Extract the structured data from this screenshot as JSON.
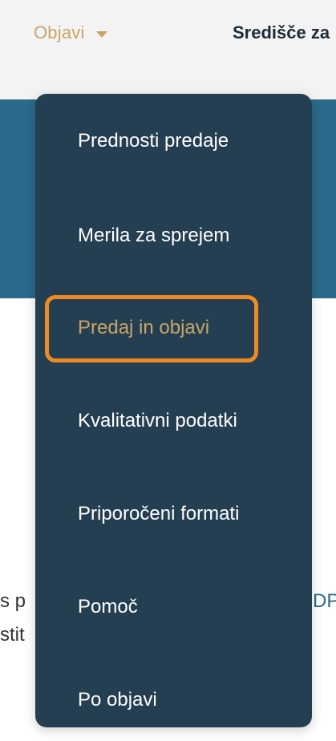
{
  "nav": {
    "objavi_label": "Objavi",
    "sredisce_label": "Središče za"
  },
  "background": {
    "text_line_1": "s p",
    "text_line_2": "stit",
    "text_right_fragment": "DP"
  },
  "dropdown": {
    "items": [
      {
        "label": "Prednosti predaje"
      },
      {
        "label": "Merila za sprejem"
      },
      {
        "label": "Predaj in objavi",
        "active": true
      },
      {
        "label": "Kvalitativni podatki"
      },
      {
        "label": "Priporočeni formati"
      },
      {
        "label": "Pomoč"
      },
      {
        "label": "Po objavi"
      }
    ]
  },
  "colors": {
    "accent_gold": "#c8a567",
    "menu_bg": "#253f52",
    "hero_blue": "#2b6a8a",
    "highlight_orange": "#f08a24"
  }
}
